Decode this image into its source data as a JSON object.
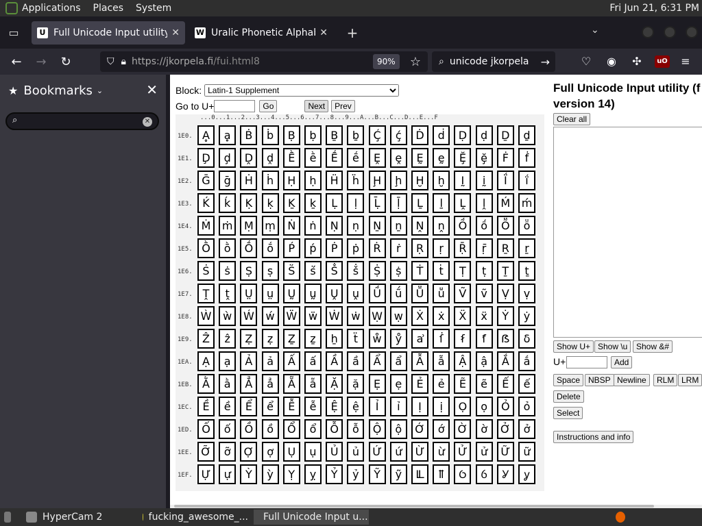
{
  "top_panel": {
    "menus": [
      "Applications",
      "Places",
      "System"
    ],
    "clock": "Fri Jun 21,  6:31 PM"
  },
  "tabs": [
    {
      "title": "Full Unicode Input utility",
      "favicon": "U",
      "active": true
    },
    {
      "title": "Uralic Phonetic Alphabet - W",
      "favicon": "W",
      "active": false
    }
  ],
  "navbar": {
    "url_host": "https://jkorpela.fi",
    "url_path": "/fui.html8",
    "zoom": "90%",
    "search_text": "unicode jkorpela"
  },
  "sidebar": {
    "title": "Bookmarks",
    "search_value": ""
  },
  "page": {
    "block_label": "Block:",
    "block_value": "Latin-1 Supplement",
    "goto_label": "Go to U+",
    "goto_value": "",
    "go_btn": "Go",
    "next_btn": "Next",
    "prev_btn": "Prev",
    "col_header": "...0...1...2...3...4...5...6...7...8...9...A...B...C...D...E...F",
    "rows": [
      {
        "label": "1E0.",
        "chars": [
          "Ḁ",
          "ḁ",
          "Ḃ",
          "ḃ",
          "Ḅ",
          "ḅ",
          "Ḇ",
          "ḇ",
          "Ḉ",
          "ḉ",
          "Ḋ",
          "ḋ",
          "Ḍ",
          "ḍ",
          "Ḏ",
          "ḏ"
        ]
      },
      {
        "label": "1E1.",
        "chars": [
          "Ḑ",
          "ḑ",
          "Ḓ",
          "ḓ",
          "Ḕ",
          "ḕ",
          "Ḗ",
          "ḗ",
          "Ḙ",
          "ḙ",
          "Ḛ",
          "ḛ",
          "Ḝ",
          "ḝ",
          "Ḟ",
          "ḟ"
        ]
      },
      {
        "label": "1E2.",
        "chars": [
          "Ḡ",
          "ḡ",
          "Ḣ",
          "ḣ",
          "Ḥ",
          "ḥ",
          "Ḧ",
          "ḧ",
          "Ḩ",
          "ḩ",
          "Ḫ",
          "ḫ",
          "Ḭ",
          "ḭ",
          "Ḯ",
          "ḯ"
        ]
      },
      {
        "label": "1E3.",
        "chars": [
          "Ḱ",
          "ḱ",
          "Ḳ",
          "ḳ",
          "Ḵ",
          "ḵ",
          "Ḷ",
          "ḷ",
          "Ḹ",
          "ḹ",
          "Ḻ",
          "ḻ",
          "Ḽ",
          "ḽ",
          "Ḿ",
          "ḿ"
        ]
      },
      {
        "label": "1E4.",
        "chars": [
          "Ṁ",
          "ṁ",
          "Ṃ",
          "ṃ",
          "Ṅ",
          "ṅ",
          "Ṇ",
          "ṇ",
          "Ṉ",
          "ṉ",
          "Ṋ",
          "ṋ",
          "Ṍ",
          "ṍ",
          "Ṏ",
          "ṏ"
        ]
      },
      {
        "label": "1E5.",
        "chars": [
          "Ṑ",
          "ṑ",
          "Ṓ",
          "ṓ",
          "Ṕ",
          "ṕ",
          "Ṗ",
          "ṗ",
          "Ṙ",
          "ṙ",
          "Ṛ",
          "ṛ",
          "Ṝ",
          "ṝ",
          "Ṟ",
          "ṟ"
        ]
      },
      {
        "label": "1E6.",
        "chars": [
          "Ṡ",
          "ṡ",
          "Ṣ",
          "ṣ",
          "Ṥ",
          "ṥ",
          "Ṧ",
          "ṧ",
          "Ṩ",
          "ṩ",
          "Ṫ",
          "ṫ",
          "Ṭ",
          "ṭ",
          "Ṯ",
          "ṯ"
        ]
      },
      {
        "label": "1E7.",
        "chars": [
          "Ṱ",
          "ṱ",
          "Ṳ",
          "ṳ",
          "Ṵ",
          "ṵ",
          "Ṷ",
          "ṷ",
          "Ṹ",
          "ṹ",
          "Ṻ",
          "ṻ",
          "Ṽ",
          "ṽ",
          "Ṿ",
          "ṿ"
        ]
      },
      {
        "label": "1E8.",
        "chars": [
          "Ẁ",
          "ẁ",
          "Ẃ",
          "ẃ",
          "Ẅ",
          "ẅ",
          "Ẇ",
          "ẇ",
          "Ẉ",
          "ẉ",
          "Ẋ",
          "ẋ",
          "Ẍ",
          "ẍ",
          "Ẏ",
          "ẏ"
        ]
      },
      {
        "label": "1E9.",
        "chars": [
          "Ẑ",
          "ẑ",
          "Ẓ",
          "ẓ",
          "Ẕ",
          "ẕ",
          "ẖ",
          "ẗ",
          "ẘ",
          "ẙ",
          "ẚ",
          "ẛ",
          "ẜ",
          "ẝ",
          "ẞ",
          "ẟ"
        ]
      },
      {
        "label": "1EA.",
        "chars": [
          "Ạ",
          "ạ",
          "Ả",
          "ả",
          "Ấ",
          "ấ",
          "Ầ",
          "ầ",
          "Ẩ",
          "ẩ",
          "Ẫ",
          "ẫ",
          "Ậ",
          "ậ",
          "Ắ",
          "ắ"
        ]
      },
      {
        "label": "1EB.",
        "chars": [
          "Ằ",
          "ằ",
          "Ẳ",
          "ẳ",
          "Ẵ",
          "ẵ",
          "Ặ",
          "ặ",
          "Ẹ",
          "ẹ",
          "Ẻ",
          "ẻ",
          "Ẽ",
          "ẽ",
          "Ế",
          "ế"
        ]
      },
      {
        "label": "1EC.",
        "chars": [
          "Ề",
          "ề",
          "Ể",
          "ể",
          "Ễ",
          "ễ",
          "Ệ",
          "ệ",
          "Ỉ",
          "ỉ",
          "Ị",
          "ị",
          "Ọ",
          "ọ",
          "Ỏ",
          "ỏ"
        ]
      },
      {
        "label": "1ED.",
        "chars": [
          "Ố",
          "ố",
          "Ồ",
          "ồ",
          "Ổ",
          "ổ",
          "Ỗ",
          "ỗ",
          "Ộ",
          "ộ",
          "Ớ",
          "ớ",
          "Ờ",
          "ờ",
          "Ở",
          "ở"
        ]
      },
      {
        "label": "1EE.",
        "chars": [
          "Ỡ",
          "ỡ",
          "Ợ",
          "ợ",
          "Ụ",
          "ụ",
          "Ủ",
          "ủ",
          "Ứ",
          "ứ",
          "Ừ",
          "ừ",
          "Ử",
          "ử",
          "Ữ",
          "ữ"
        ]
      },
      {
        "label": "1EF.",
        "chars": [
          "Ự",
          "ự",
          "Ỳ",
          "ỳ",
          "Ỵ",
          "ỵ",
          "Ỷ",
          "ỷ",
          "Ỹ",
          "ỹ",
          "Ỻ",
          "ỻ",
          "Ỽ",
          "ỽ",
          "Ỿ",
          "ỿ"
        ]
      }
    ],
    "heading_line1": "Full Unicode Input utility (f",
    "heading_link": "version",
    "heading_tail": " 14)",
    "clear_all": "Clear all",
    "show_uplus": "Show U+",
    "show_u": "Show \\u",
    "show_amp": "Show &#",
    "uplus_label": "U+",
    "add_btn": "Add",
    "space_btn": "Space",
    "nbsp_btn": "NBSP",
    "newline_btn": "Newline",
    "rlm_btn": "RLM",
    "lrm_btn": "LRM",
    "delete_btn": "Delete",
    "select_btn": "Select",
    "instructions_btn": "Instructions and info"
  },
  "taskbar": {
    "items": [
      "HyperCam 2",
      "fucking_awesome_...",
      "Full Unicode Input u..."
    ]
  },
  "colors": {
    "panel_bg": "#2f2f2f",
    "browser_chrome": "#2b2a33",
    "sidebar_bg": "#38373f",
    "page_bg": "#ffffff",
    "link": "#0000ee"
  }
}
